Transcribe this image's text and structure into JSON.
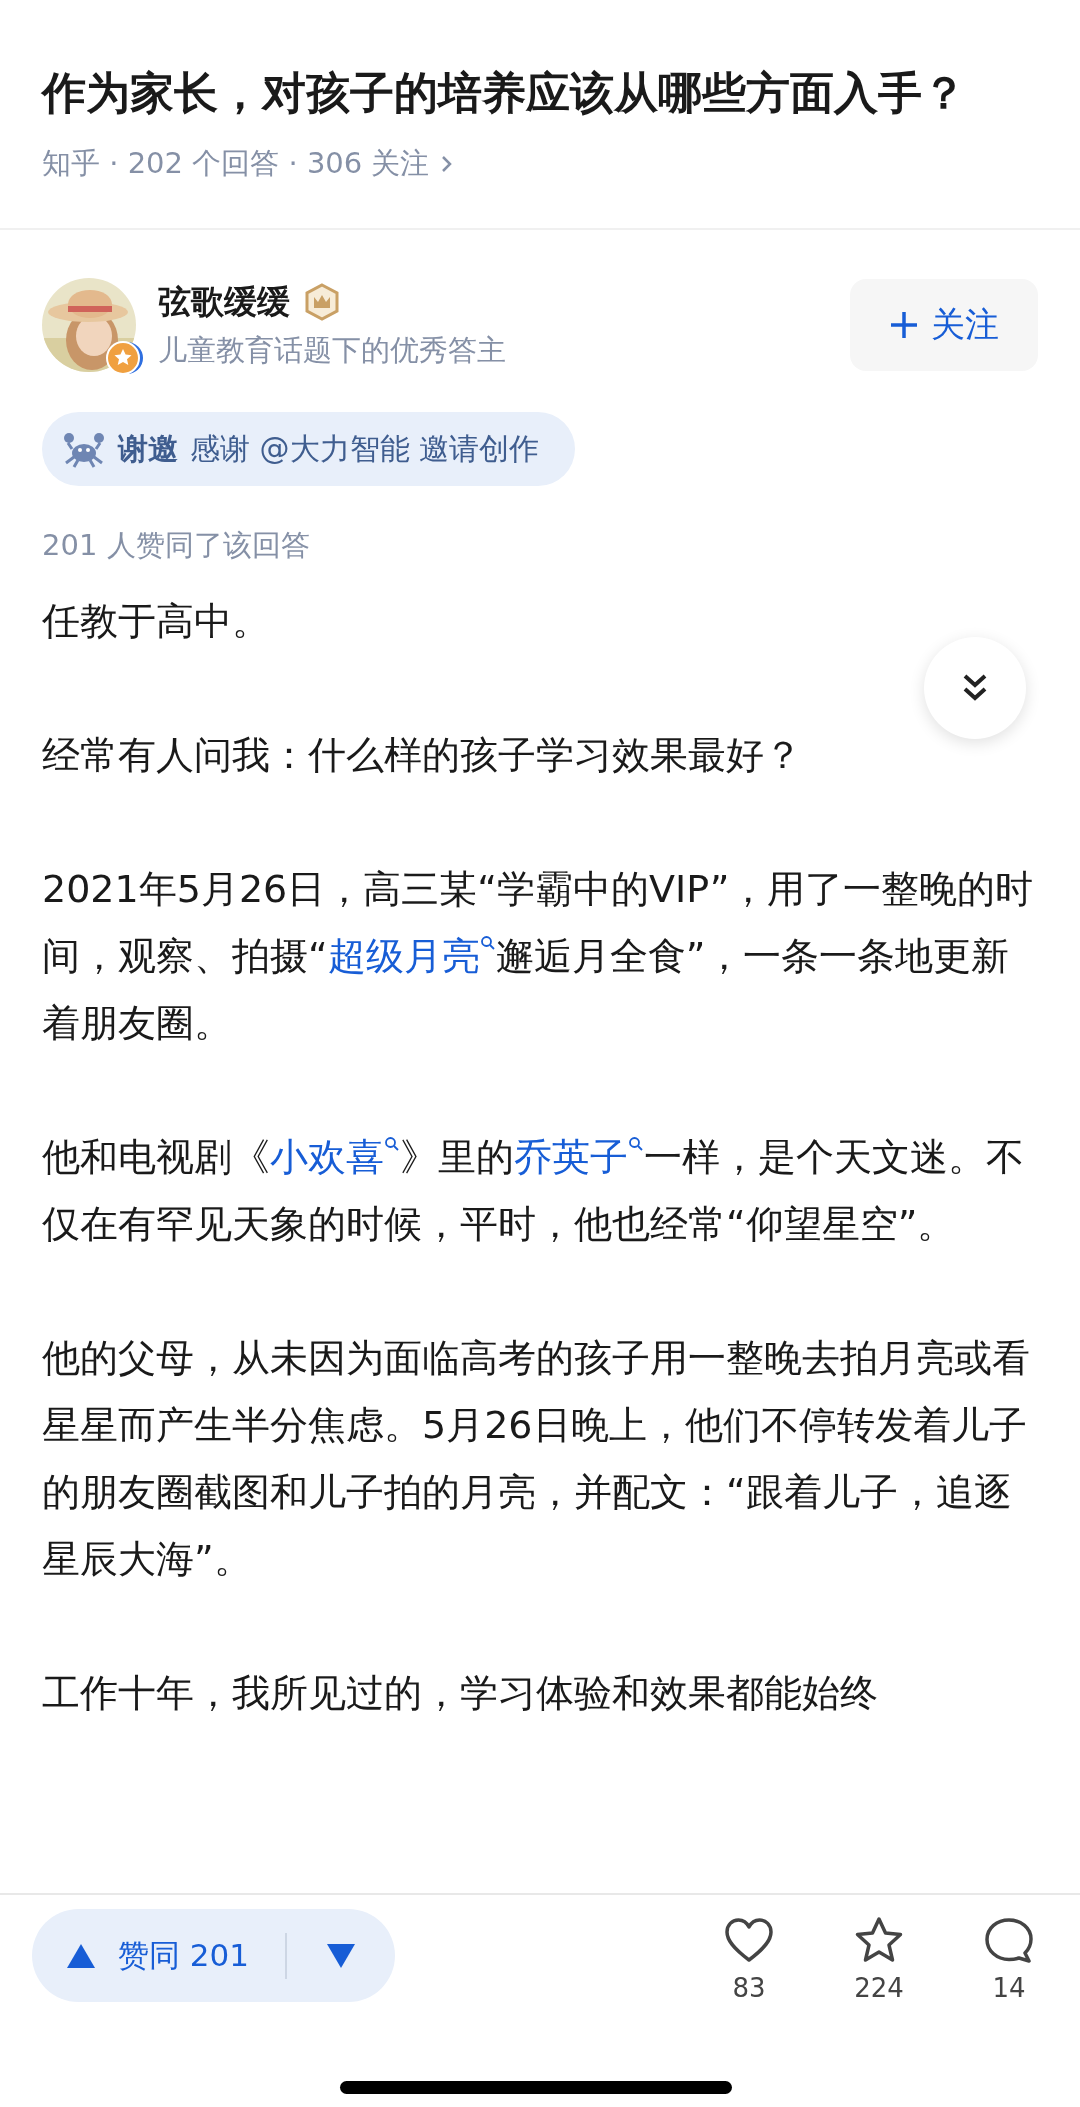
{
  "question": {
    "title": "作为家长，对孩子的培养应该从哪些方面入手？",
    "meta": "知乎 · 202 个回答 · 306 关注"
  },
  "author": {
    "name": "弦歌缓缓",
    "subtitle": "儿童教育话题下的优秀答主",
    "follow": "关注"
  },
  "invitation": {
    "label": "谢邀",
    "text": "感谢 @大力智能 邀请创作"
  },
  "upvote_summary": "201 人赞同了该回答",
  "paragraphs": [
    [
      {
        "kind": "text",
        "text": "任教于高中。"
      }
    ],
    [
      {
        "kind": "text",
        "text": "经常有人问我：什么样的孩子学习效果最好？"
      }
    ],
    [
      {
        "kind": "text",
        "text": "2021年5月26日，高三某“学霸中的VIP”，用了一整晚的时间，观察、拍摄“"
      },
      {
        "kind": "link",
        "text": "超级月亮"
      },
      {
        "kind": "text",
        "text": "邂逅月全食”，一条一条地更新着朋友圈。"
      }
    ],
    [
      {
        "kind": "text",
        "text": "他和电视剧《"
      },
      {
        "kind": "link",
        "text": "小欢喜"
      },
      {
        "kind": "text",
        "text": "》里的"
      },
      {
        "kind": "link",
        "text": "乔英子"
      },
      {
        "kind": "text",
        "text": "一样，是个天文迷。不仅在有罕见天象的时候，平时，他也经常“仰望星空”。"
      }
    ],
    [
      {
        "kind": "text",
        "text": "他的父母，从未因为面临高考的孩子用一整晚去拍月亮或看星星而产生半分焦虑。5月26日晚上，他们不停转发着儿子的朋友圈截图和儿子拍的月亮，并配文：“跟着儿子，追逐星辰大海”。"
      }
    ],
    [
      {
        "kind": "text",
        "text": "工作十年，我所见过的，学习体验和效果都能始终"
      }
    ]
  ],
  "bottom_bar": {
    "upvote": "赞同 201",
    "actions": [
      {
        "kind": "like",
        "count": "83"
      },
      {
        "kind": "favorite",
        "count": "224"
      },
      {
        "kind": "comment",
        "count": "14"
      }
    ]
  }
}
